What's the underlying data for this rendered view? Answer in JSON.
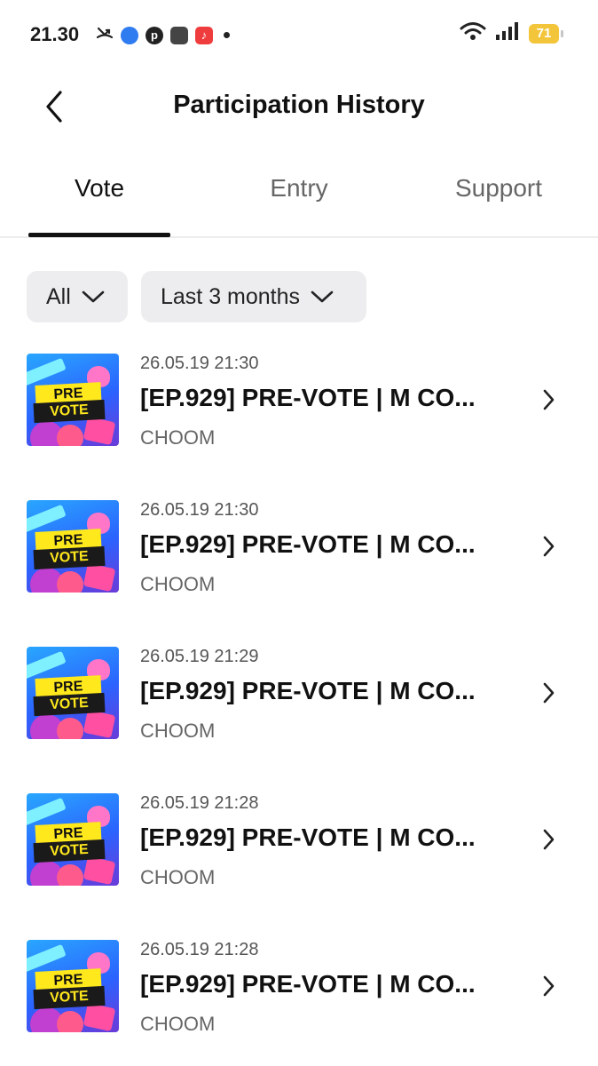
{
  "status_bar": {
    "time": "21.30",
    "battery": "71"
  },
  "header": {
    "title": "Participation History"
  },
  "tabs": [
    {
      "label": "Vote",
      "active": true
    },
    {
      "label": "Entry",
      "active": false
    },
    {
      "label": "Support",
      "active": false
    }
  ],
  "filters": {
    "type": "All",
    "period": "Last 3 months"
  },
  "thumbnail": {
    "line1": "PRE",
    "line2": "VOTE"
  },
  "items": [
    {
      "date": "26.05.19 21:30",
      "title": "[EP.929] PRE-VOTE | M CO...",
      "artist": "CHOOM"
    },
    {
      "date": "26.05.19 21:30",
      "title": "[EP.929] PRE-VOTE | M CO...",
      "artist": "CHOOM"
    },
    {
      "date": "26.05.19 21:29",
      "title": "[EP.929] PRE-VOTE | M CO...",
      "artist": "CHOOM"
    },
    {
      "date": "26.05.19 21:28",
      "title": "[EP.929] PRE-VOTE | M CO...",
      "artist": "CHOOM"
    },
    {
      "date": "26.05.19 21:28",
      "title": "[EP.929] PRE-VOTE | M CO...",
      "artist": "CHOOM"
    }
  ]
}
